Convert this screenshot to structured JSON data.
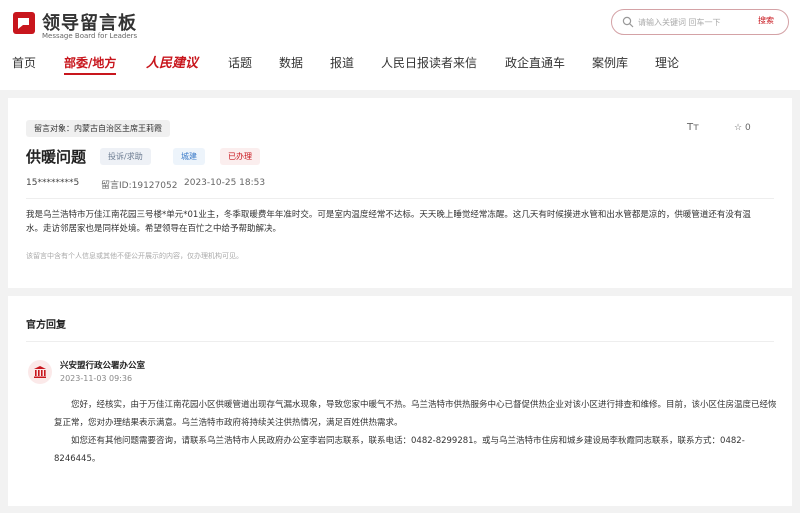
{
  "logo": {
    "title": "领导留言板",
    "subtitle": "Message Board for Leaders",
    "color": "#c8161d"
  },
  "search": {
    "placeholder": "请输入关键词 回车一下",
    "button": "搜索"
  },
  "nav": {
    "items": [
      {
        "label": "首页"
      },
      {
        "label": "部委/地方",
        "active": true
      },
      {
        "label": "人民建议"
      },
      {
        "label": "话题"
      },
      {
        "label": "数据"
      },
      {
        "label": "报道"
      },
      {
        "label": "人民日报读者来信"
      },
      {
        "label": "政企直通车"
      },
      {
        "label": "案例库"
      },
      {
        "label": "理论"
      }
    ]
  },
  "message": {
    "target": "留言对象：内蒙古自治区主席王莉霞",
    "font_icon": "Tт",
    "fav_count": "0",
    "title": "供暖问题",
    "tags": [
      "投诉/求助",
      "城建",
      "已办理"
    ],
    "user": "15********5",
    "id": "留言ID:19127052",
    "date": "2023-10-25 18:53",
    "content": "我是乌兰浩特市万佳江南花园三号楼*单元*01业主，冬季取暖费年年准时交。可是室内温度经常不达标。天天晚上睡觉经常冻醒。这几天有时候摸进水管和出水管都是凉的，供暖管道还有没有温水。走访邻居家也是同样处境。希望领导在百忙之中给予帮助解决。",
    "note": "该留言中含有个人信息或其他不便公开展示的内容，仅办理机构可见。"
  },
  "reply": {
    "section_title": "官方回复",
    "org": "兴安盟行政公署办公室",
    "date": "2023-11-03 09:36",
    "para1": "您好，经核实，由于万佳江南花园小区供暖管道出现存气漏水现象，导致您家中暖气不热。乌兰浩特市供热服务中心已督促供热企业对该小区进行排查和维修。目前，该小区住房温度已经恢复正常，您对办理结果表示满意。乌兰浩特市政府将持续关注供热情况，满足百姓供热需求。",
    "para2": "如您还有其他问题需要咨询，请联系乌兰浩特市人民政府办公室李岩同志联系，联系电话：0482-8299281。或与乌兰浩特市住房和城乡建设局李秋霞同志联系，联系方式：0482-8246445。"
  }
}
